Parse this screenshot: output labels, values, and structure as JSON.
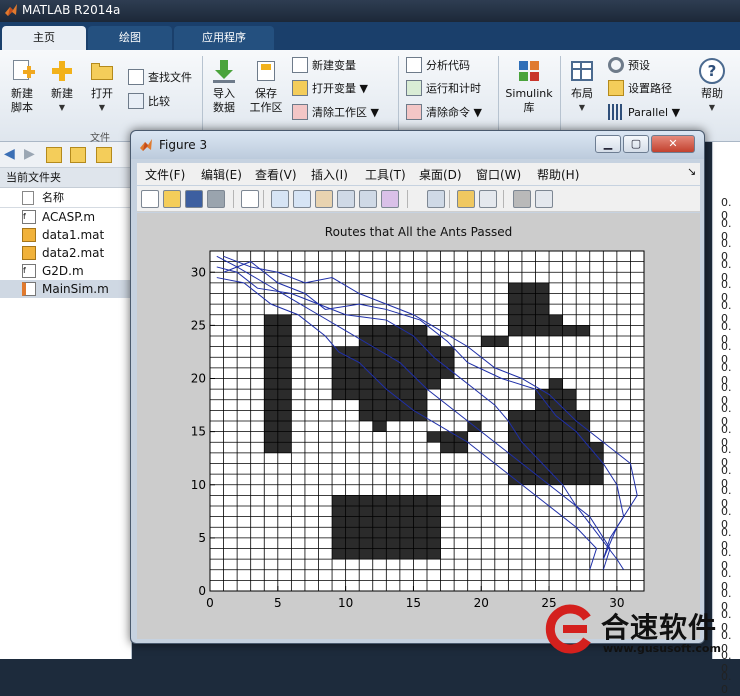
{
  "app": {
    "title": "MATLAB R2014a"
  },
  "tabs": [
    {
      "label": "主页",
      "active": true
    },
    {
      "label": "绘图",
      "active": false
    },
    {
      "label": "应用程序",
      "active": false
    }
  ],
  "ribbon": {
    "new_script": "新建\n脚本",
    "new": "新建",
    "open": "打开",
    "find_files": "查找文件",
    "compare": "比较",
    "file_group": "文件",
    "import_data": "导入\n数据",
    "save_workspace": "保存\n工作区",
    "new_variable": "新建变量",
    "open_variable": "打开变量",
    "clear_workspace": "清除工作区",
    "analyze_code": "分析代码",
    "run_and_time": "运行和计时",
    "clear_commands": "清除命令",
    "simulink": "Simulink\n库",
    "layout": "布局",
    "preferences": "预设",
    "set_path": "设置路径",
    "parallel": "Parallel",
    "help": "帮助"
  },
  "current_folder": {
    "header": "当前文件夹",
    "name_column": "名称",
    "files": [
      {
        "name": "ACASP.m",
        "type": "function"
      },
      {
        "name": "data1.mat",
        "type": "mat"
      },
      {
        "name": "data2.mat",
        "type": "mat"
      },
      {
        "name": "G2D.m",
        "type": "function"
      },
      {
        "name": "MainSim.m",
        "type": "script",
        "selected": true
      }
    ]
  },
  "workspace_values": [
    "0. 0",
    "0. 0",
    "0. 0",
    "0. 0",
    "0. 0",
    "0. 0",
    "0. 0",
    "0. 0",
    "0. 0",
    "0. 0",
    "0. 0",
    "0. 0",
    "0. 0",
    "0. 0",
    "0. 0",
    "0. 0",
    "0. 0",
    "0. 0",
    "0. 0",
    "0. 0",
    "0. 0",
    "0. 0",
    "0. 0",
    "0. 0"
  ],
  "figure": {
    "title": "Figure 3",
    "window_buttons": [
      "▁",
      "▢",
      "✕"
    ],
    "menu": [
      "文件(F)",
      "编辑(E)",
      "查看(V)",
      "插入(I)",
      "工具(T)",
      "桌面(D)",
      "窗口(W)",
      "帮助(H)"
    ],
    "toolbar_icons": [
      "new-figure-icon",
      "open-file-icon",
      "save-icon",
      "print-icon",
      "pointer-icon",
      "zoom-in-icon",
      "zoom-out-icon",
      "pan-hand-icon",
      "rotate-3d-icon",
      "data-cursor-icon",
      "brush-icon",
      "link-plot-icon",
      "colorbar-icon",
      "legend-icon",
      "hide-plot-tools-icon",
      "show-plot-tools-icon"
    ]
  },
  "chart_data": {
    "type": "grid-map",
    "title": "Routes that All the Ants Passed",
    "xlim": [
      0,
      32
    ],
    "ylim": [
      0,
      32
    ],
    "xticks": [
      0,
      5,
      10,
      15,
      20,
      25,
      30
    ],
    "yticks": [
      0,
      5,
      10,
      15,
      20,
      25,
      30
    ],
    "grid": true,
    "obstacle_color": "#2b2b2b",
    "route_color": "#1f2fa8",
    "obstacles": [
      [
        4,
        13,
        6,
        26
      ],
      [
        9,
        3,
        17,
        9
      ],
      [
        22,
        24,
        25,
        29
      ],
      [
        20,
        23,
        22,
        24
      ],
      [
        25,
        24,
        26,
        26
      ],
      [
        26,
        24,
        28,
        25
      ],
      [
        11,
        16,
        16,
        25
      ],
      [
        9,
        18,
        11,
        23
      ],
      [
        16,
        19,
        17,
        24
      ],
      [
        17,
        20,
        18,
        23
      ],
      [
        12,
        15,
        13,
        16
      ],
      [
        15,
        17,
        16,
        18
      ],
      [
        16,
        14,
        19,
        15
      ],
      [
        17,
        13,
        19,
        14
      ],
      [
        19,
        15,
        20,
        16
      ],
      [
        22,
        10,
        28,
        17
      ],
      [
        24,
        17,
        27,
        19
      ],
      [
        25,
        19,
        26,
        20
      ],
      [
        28,
        10,
        29,
        14
      ]
    ],
    "routes": [
      [
        [
          0.5,
          31.5
        ],
        [
          2,
          30.5
        ],
        [
          4,
          29
        ],
        [
          6,
          27.5
        ],
        [
          8,
          26
        ],
        [
          10,
          24.5
        ],
        [
          12,
          23
        ],
        [
          14,
          21.5
        ],
        [
          16,
          19
        ],
        [
          18,
          17
        ],
        [
          20,
          15
        ],
        [
          22,
          13
        ],
        [
          24,
          11
        ],
        [
          26,
          9
        ],
        [
          28,
          7
        ],
        [
          29.5,
          4
        ],
        [
          29,
          2
        ]
      ],
      [
        [
          0.5,
          30.5
        ],
        [
          2,
          30
        ],
        [
          3.5,
          28.5
        ],
        [
          6,
          28
        ],
        [
          8,
          27
        ],
        [
          10,
          26
        ],
        [
          13,
          25.5
        ],
        [
          15,
          24
        ],
        [
          16.5,
          22
        ],
        [
          18,
          20.5
        ],
        [
          19.5,
          19
        ],
        [
          21,
          17.5
        ],
        [
          22,
          16
        ],
        [
          23,
          14
        ],
        [
          24.5,
          12
        ],
        [
          26,
          10
        ],
        [
          27,
          8
        ],
        [
          28.5,
          5.5
        ],
        [
          30,
          3
        ],
        [
          30.5,
          2
        ]
      ],
      [
        [
          1,
          31.5
        ],
        [
          3,
          30.5
        ],
        [
          5,
          30
        ],
        [
          7,
          29
        ],
        [
          9,
          29.5
        ],
        [
          11,
          28
        ],
        [
          13,
          27
        ],
        [
          15,
          26
        ],
        [
          17,
          24.5
        ],
        [
          19,
          23
        ],
        [
          21,
          21
        ],
        [
          23,
          20
        ],
        [
          25,
          18.5
        ],
        [
          27,
          16
        ],
        [
          29,
          14
        ],
        [
          31,
          12
        ],
        [
          31.5,
          9
        ],
        [
          30,
          6
        ],
        [
          29,
          3
        ]
      ],
      [
        [
          0.5,
          29.5
        ],
        [
          2.5,
          29
        ],
        [
          4.5,
          27
        ],
        [
          6.5,
          26
        ],
        [
          8.5,
          24
        ],
        [
          9.5,
          22.5
        ],
        [
          11,
          21.5
        ],
        [
          13,
          19
        ],
        [
          15,
          17
        ],
        [
          17,
          15.5
        ],
        [
          19,
          14
        ],
        [
          21,
          12
        ],
        [
          23,
          10
        ],
        [
          25,
          8
        ],
        [
          27,
          6
        ],
        [
          28.5,
          4
        ],
        [
          28,
          2
        ]
      ],
      [
        [
          1,
          30
        ],
        [
          3,
          31
        ],
        [
          5,
          29
        ],
        [
          7,
          28
        ],
        [
          8.5,
          26.5
        ],
        [
          11,
          27
        ],
        [
          13,
          26.5
        ],
        [
          15.5,
          25.5
        ],
        [
          17.5,
          23.5
        ],
        [
          19,
          21.5
        ],
        [
          21.5,
          20
        ],
        [
          24,
          19
        ],
        [
          25.5,
          16.5
        ],
        [
          27,
          15
        ],
        [
          29,
          12
        ],
        [
          30,
          10
        ],
        [
          30.5,
          7
        ],
        [
          29.5,
          5
        ],
        [
          29,
          3
        ]
      ]
    ]
  },
  "watermark": {
    "name": "合速软件",
    "url": "www.gususoft.com"
  }
}
